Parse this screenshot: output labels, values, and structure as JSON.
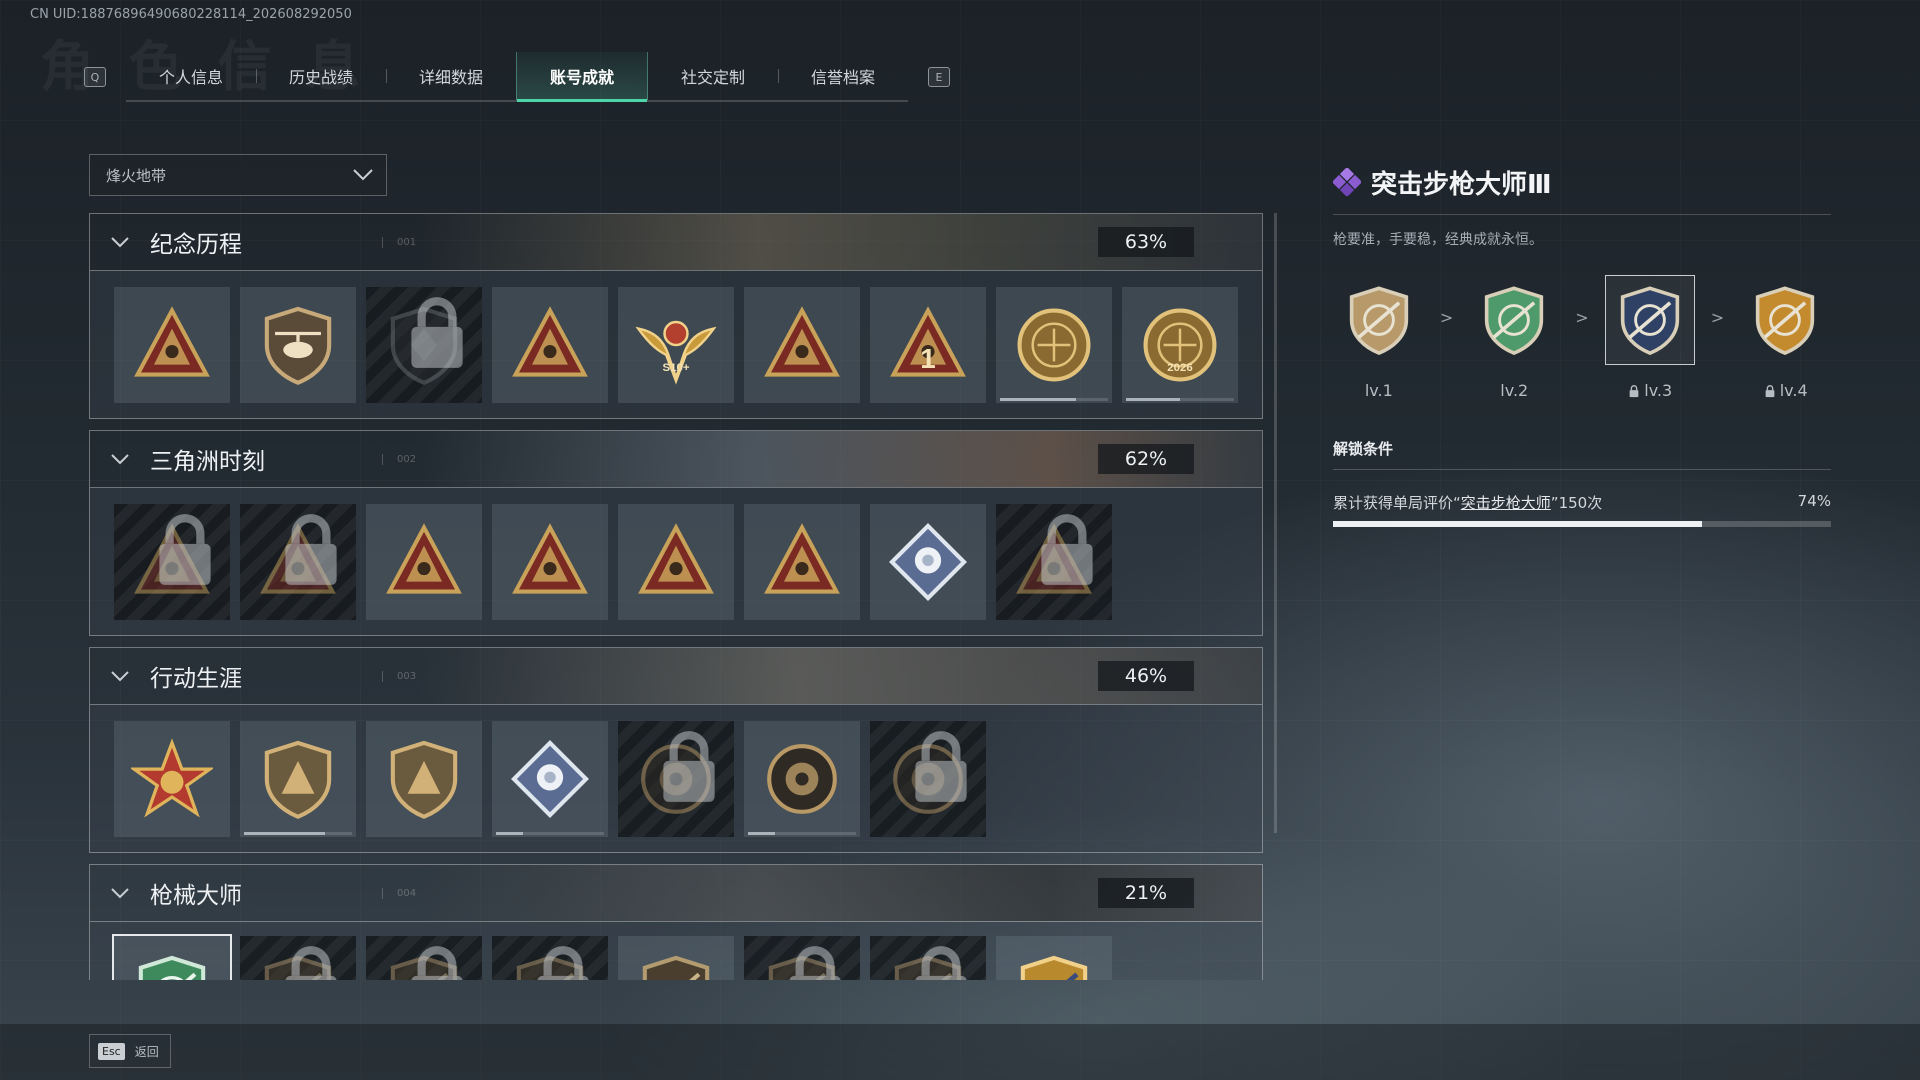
{
  "uid": "CN UID:18876896490680228114_202608292050",
  "tabs": {
    "left_key": "Q",
    "right_key": "E",
    "items": [
      {
        "label": "个人信息",
        "active": false
      },
      {
        "label": "历史战绩",
        "active": false
      },
      {
        "label": "详细数据",
        "active": false
      },
      {
        "label": "账号成就",
        "active": true
      },
      {
        "label": "社交定制",
        "active": false
      },
      {
        "label": "信誉档案",
        "active": false
      }
    ]
  },
  "filter": {
    "selected": "烽火地带"
  },
  "sections": [
    {
      "title": "纪念历程",
      "number": "001",
      "percent": "63%",
      "badges": [
        {
          "icon": "triangle-badge-icon",
          "locked": false
        },
        {
          "icon": "helicopter-badge-icon",
          "locked": false
        },
        {
          "icon": "dark-shield-badge-icon",
          "locked": true
        },
        {
          "icon": "triangle-crate-badge-icon",
          "locked": false
        },
        {
          "icon": "winged-crest-badge-icon",
          "locked": false,
          "text": "S10+"
        },
        {
          "icon": "triangle-fist-badge-icon",
          "locked": false
        },
        {
          "icon": "number-one-badge-icon",
          "locked": false,
          "text": "1"
        },
        {
          "icon": "delta-force-badge-icon",
          "locked": false,
          "progress": 0.7
        },
        {
          "icon": "delta-force-2026-badge-icon",
          "locked": false,
          "text": "2026",
          "progress": 0.5
        }
      ]
    },
    {
      "title": "三角洲时刻",
      "number": "002",
      "percent": "62%",
      "badges": [
        {
          "icon": "triangle-soldier-badge-icon",
          "locked": true
        },
        {
          "icon": "triangle-runner-badge-icon",
          "locked": true
        },
        {
          "icon": "triangle-skull-badge-icon",
          "locked": false
        },
        {
          "icon": "triangle-squad-badge-icon",
          "locked": false
        },
        {
          "icon": "triangle-beasts-badge-icon",
          "locked": false
        },
        {
          "icon": "triangle-dragon-badge-icon",
          "locked": false
        },
        {
          "icon": "diamond-rose-badge-icon",
          "locked": false
        },
        {
          "icon": "triangle-eagle-badge-icon",
          "locked": true
        }
      ]
    },
    {
      "title": "行动生涯",
      "number": "003",
      "percent": "46%",
      "badges": [
        {
          "icon": "star-medal-badge-icon",
          "locked": false
        },
        {
          "icon": "bronze-shield-badge-icon",
          "locked": false,
          "progress": 0.75
        },
        {
          "icon": "gold-star-shield-badge-icon",
          "locked": false
        },
        {
          "icon": "silver-diamond-shield-badge-icon",
          "locked": false,
          "progress": 0.25
        },
        {
          "icon": "round-helmet-badge-icon",
          "locked": true
        },
        {
          "icon": "round-spy-badge-icon",
          "locked": false,
          "progress": 0.25
        },
        {
          "icon": "round-eye-badge-icon",
          "locked": true
        }
      ]
    },
    {
      "title": "枪械大师",
      "number": "004",
      "percent": "21%",
      "badges": [
        {
          "icon": "rifle-master-badge-icon",
          "locked": false,
          "selected": true
        },
        {
          "icon": "gun-badge-icon",
          "locked": true
        },
        {
          "icon": "gun-badge-icon",
          "locked": true
        },
        {
          "icon": "gun-badge-icon",
          "locked": true
        },
        {
          "icon": "gun-badge-icon",
          "locked": false
        },
        {
          "icon": "gun-badge-icon",
          "locked": true
        },
        {
          "icon": "gun-badge-icon",
          "locked": true
        },
        {
          "icon": "gold-gun-badge-icon",
          "locked": false
        }
      ]
    }
  ],
  "detail": {
    "title": "突击步枪大师Ⅲ",
    "description": "枪要准，手要稳，经典成就永恒。",
    "levels": [
      {
        "label": "lv.1",
        "locked": false,
        "color": "#b89a6a"
      },
      {
        "label": "lv.2",
        "locked": false,
        "color": "#4f9a6a"
      },
      {
        "label": "lv.3",
        "locked": true,
        "color": "#2f4266",
        "selected": true
      },
      {
        "label": "lv.4",
        "locked": true,
        "color": "#c48a2e"
      }
    ],
    "separator": ">",
    "unlock_title": "解锁条件",
    "condition_prefix": "累计获得单局评价“",
    "condition_link": "突击步枪大师",
    "condition_suffix": "”150次",
    "progress_text": "74%",
    "progress": 0.74
  },
  "footer": {
    "key": "Esc",
    "label": "返回"
  },
  "colors": {
    "accent": "#4fd6a8",
    "gem": "#9b6bd6"
  }
}
